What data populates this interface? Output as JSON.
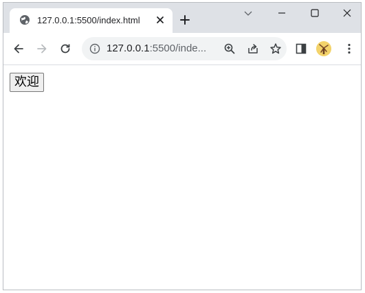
{
  "tab": {
    "title": "127.0.0.1:5500/index.html"
  },
  "address_bar": {
    "url_host": "127.0.0.1",
    "url_rest": ":5500/inde..."
  },
  "page": {
    "welcome_button_label": "欢迎"
  },
  "icons": {
    "favicon": "globe-icon",
    "tab_close": "close-icon",
    "new_tab": "plus-icon",
    "back": "back-arrow-icon",
    "forward": "forward-arrow-icon",
    "reload": "reload-icon",
    "site_info": "info-icon",
    "zoom": "zoom-icon",
    "share": "share-icon",
    "bookmark": "star-icon",
    "side_panel": "side-panel-icon",
    "profile": "avatar",
    "menu": "kebab-menu-icon"
  },
  "colors": {
    "tabstrip_bg": "#dee1e6",
    "omnibox_bg": "#f1f3f4",
    "forward_disabled": "#b8bbbf"
  }
}
